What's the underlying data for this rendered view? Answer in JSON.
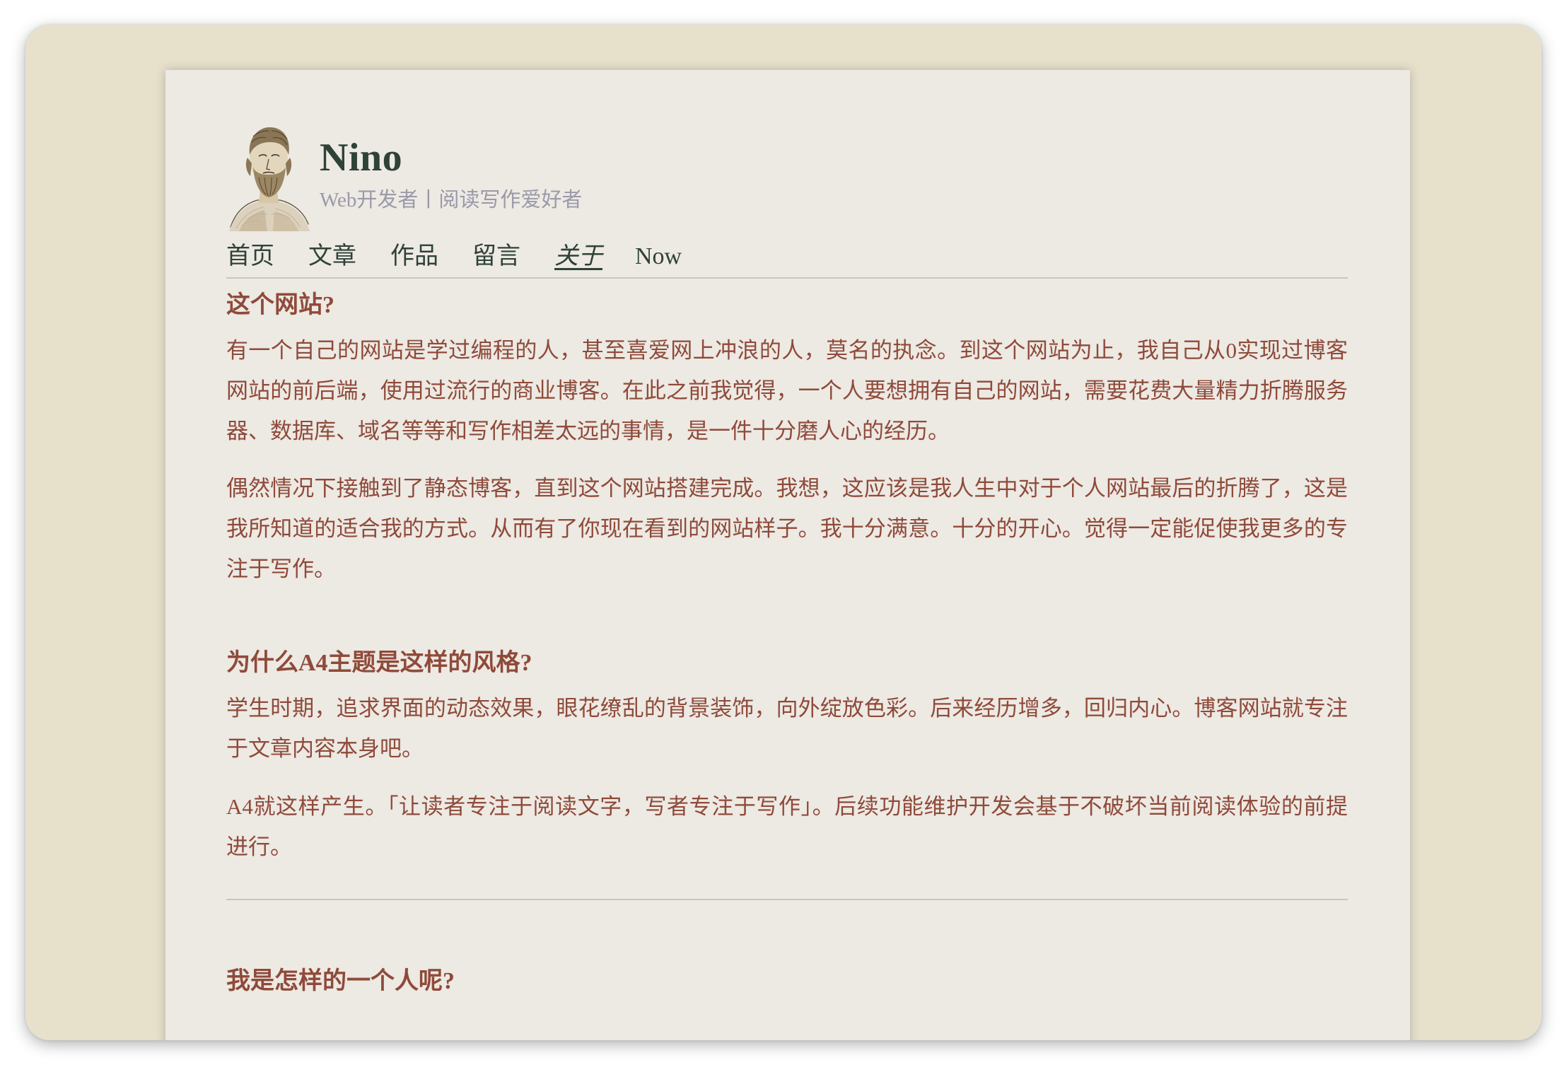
{
  "site": {
    "title": "Nino",
    "subtitle": "Web开发者丨阅读写作爱好者",
    "avatar_icon": "philosopher-bust-portrait"
  },
  "nav": {
    "items": [
      {
        "label": "首页",
        "active": false
      },
      {
        "label": "文章",
        "active": false
      },
      {
        "label": "作品",
        "active": false
      },
      {
        "label": "留言",
        "active": false
      },
      {
        "label": "关于",
        "active": true
      },
      {
        "label": "Now",
        "active": false
      }
    ]
  },
  "content": {
    "section1": {
      "heading": "这个网站?",
      "paragraphs": [
        "有一个自己的网站是学过编程的人，甚至喜爱网上冲浪的人，莫名的执念。到这个网站为止，我自己从0实现过博客网站的前后端，使用过流行的商业博客。在此之前我觉得，一个人要想拥有自己的网站，需要花费大量精力折腾服务器、数据库、域名等等和写作相差太远的事情，是一件十分磨人心的经历。",
        "偶然情况下接触到了静态博客，直到这个网站搭建完成。我想，这应该是我人生中对于个人网站最后的折腾了，这是我所知道的适合我的方式。从而有了你现在看到的网站样子。我十分满意。十分的开心。觉得一定能促使我更多的专注于写作。"
      ]
    },
    "section2": {
      "heading": "为什么A4主题是这样的风格?",
      "paragraphs": [
        "学生时期，追求界面的动态效果，眼花缭乱的背景装饰，向外绽放色彩。后来经历增多，回归内心。博客网站就专注于文章内容本身吧。",
        "A4就这样产生。「让读者专注于阅读文字，写者专注于写作」。后续功能维护开发会基于不破坏当前阅读体验的前提进行。"
      ]
    },
    "section3": {
      "heading": "我是怎样的一个人呢?"
    }
  },
  "colors": {
    "window_bg": "#e7e1cc",
    "paper_bg": "#ede9e3",
    "title": "#2f4238",
    "subtitle": "#9a9aa8",
    "body_text": "#8f4a3a",
    "rule": "#c9c5c0"
  }
}
